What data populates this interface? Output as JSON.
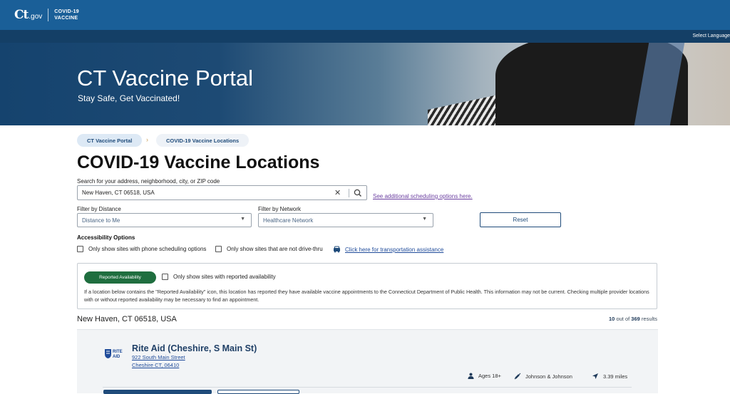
{
  "header": {
    "logo_ct": "Ct",
    "logo_gov": ".gov",
    "logo_sub_line1": "COVID-19",
    "logo_sub_line2": "VACCINE",
    "language": "Select Language"
  },
  "hero": {
    "title": "CT Vaccine Portal",
    "subtitle": "Stay Safe, Get Vaccinated!"
  },
  "breadcrumb": [
    "CT Vaccine Portal",
    "COVID-19 Vaccine Locations"
  ],
  "page_title": "COVID-19 Vaccine Locations",
  "search": {
    "label": "Search for your address, neighborhood, city, or ZIP code",
    "value": "New Haven, CT 06518, USA",
    "additional_link": "See additional scheduling options here."
  },
  "filters": {
    "distance_label": "Filter by Distance",
    "distance_value": "Distance to Me",
    "network_label": "Filter by Network",
    "network_value": "Healthcare Network",
    "reset_label": "Reset"
  },
  "accessibility": {
    "title": "Accessibility Options",
    "option_phone": "Only show sites with phone scheduling options",
    "option_drive": "Only show sites that are not drive-thru",
    "transport_link": "Click here for transportation assistance"
  },
  "availability": {
    "badge": "Reported Availability",
    "checkbox_label": "Only show sites with reported availability",
    "description": "If a location below contains the \"Reported Availability\" icon, this location has reported they have available vaccine appointments to the Connecticut Department of Public Health. This information may not be current. Checking multiple provider locations with or without reported availability may be necessary to find an appointment."
  },
  "results": {
    "location": "New Haven, CT 06518, USA",
    "shown": "10",
    "out_of": " out of ",
    "total": "369",
    "suffix": " results"
  },
  "card": {
    "logo_line1": "RITE",
    "logo_line2": "AID",
    "title": "Rite Aid (Cheshire, S Main St)",
    "address_line1": "922 South Main Street",
    "address_line2": "Cheshire CT, 06410",
    "age": "Ages 18+",
    "vaccine": "Johnson & Johnson",
    "distance": "3.39 miles"
  },
  "colors": {
    "header_blue": "#1a5f98",
    "badge_green": "#1f6e3f",
    "link_purple": "#6b3fa0",
    "link_blue": "#1f4b9a"
  }
}
